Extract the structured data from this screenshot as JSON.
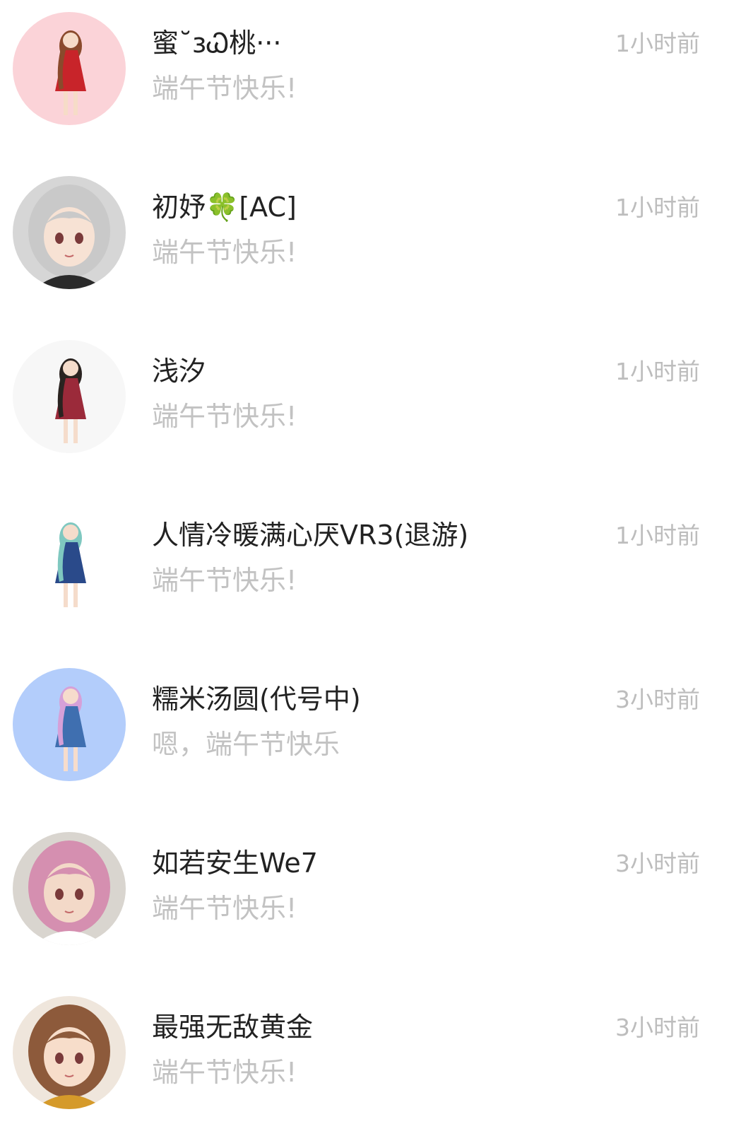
{
  "conversations": [
    {
      "name": "蜜˘ɜᏇ桃···",
      "message": "端午节快乐!",
      "time": "1小时前",
      "avatar": {
        "icon": "avatar-girl-red-dress",
        "bg": "#fbd3d8",
        "hair": "#8a4a2c",
        "outfit": "#c8242a",
        "skin": "#f6dcc8"
      }
    },
    {
      "name": "初妤🍀[AC]",
      "message": "端午节快乐!",
      "time": "1小时前",
      "avatar": {
        "icon": "avatar-girl-silver-hair",
        "bg": "#d6d6d6",
        "hair": "#c9c9c9",
        "outfit": "#2a2a2a",
        "skin": "#f7e2d4"
      }
    },
    {
      "name": "浅汐",
      "message": "端午节快乐!",
      "time": "1小时前",
      "avatar": {
        "icon": "avatar-girl-white-top-red-skirt",
        "bg": "#f7f7f7",
        "hair": "#2a2320",
        "outfit": "#9b2a3a",
        "skin": "#f5dccb"
      }
    },
    {
      "name": "人情冷暖满心厌VR3(退游)",
      "message": "端午节快乐!",
      "time": "1小时前",
      "avatar": {
        "icon": "avatar-girl-teal-hair-blue-dress",
        "bg": "#ffffff",
        "hair": "#7fc8c0",
        "outfit": "#2a4a8a",
        "skin": "#f5dccb"
      }
    },
    {
      "name": "糯米汤圆(代号中)",
      "message": "嗯，端午节快乐",
      "time": "3小时前",
      "avatar": {
        "icon": "avatar-girl-pink-hair-blue-background",
        "bg": "#b3cdfb",
        "hair": "#d6a0d8",
        "outfit": "#3f6fb0",
        "skin": "#f6dccc"
      }
    },
    {
      "name": "如若安生We7",
      "message": "端午节快乐!",
      "time": "3小时前",
      "avatar": {
        "icon": "avatar-girl-pink-braids",
        "bg": "#d9d5cf",
        "hair": "#d58fb0",
        "outfit": "#ffffff",
        "skin": "#f3d9c8"
      }
    },
    {
      "name": "最强无敌黄金",
      "message": "端午节快乐!",
      "time": "3小时前",
      "avatar": {
        "icon": "avatar-girl-brown-hair-pharaoh",
        "bg": "#efe6dc",
        "hair": "#8d5a3b",
        "outfit": "#d59a2a",
        "skin": "#f7ddca"
      }
    }
  ]
}
